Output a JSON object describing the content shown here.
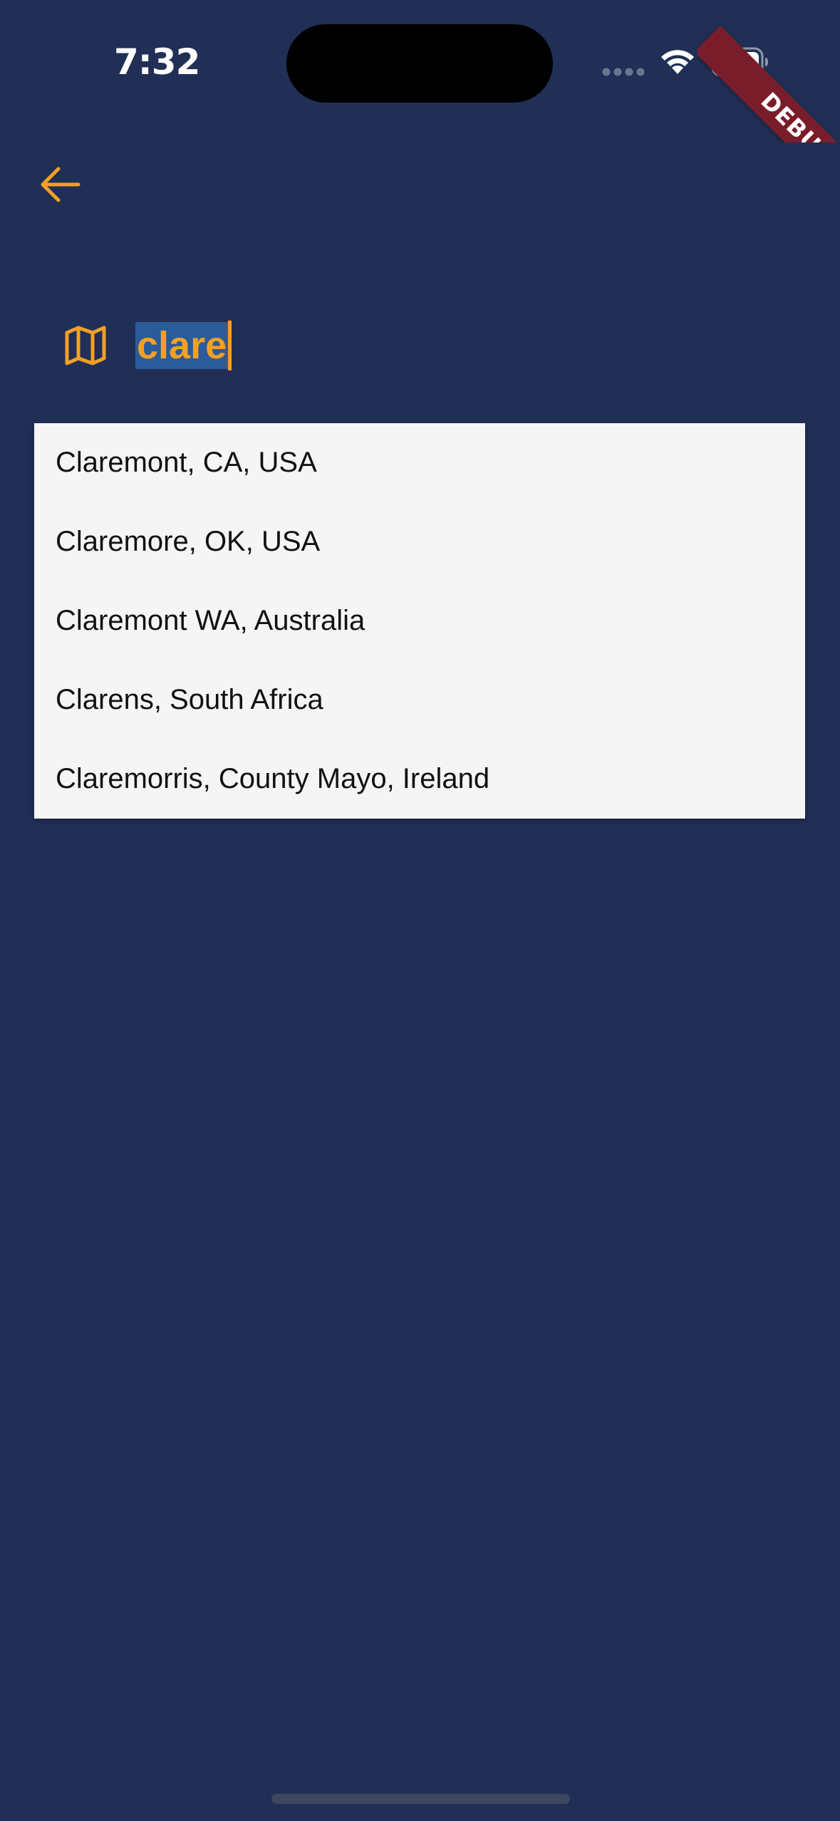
{
  "status_bar": {
    "time": "7:32",
    "icons": [
      "cellular-signal-icon",
      "wifi-icon",
      "battery-icon"
    ]
  },
  "debug_banner": {
    "label": "DEBUG",
    "color": "#7a1d2a"
  },
  "app_bar": {
    "back_icon": "arrow-back-icon"
  },
  "search": {
    "leading_icon": "map-icon",
    "value": "clare",
    "selection_color": "#2b5c99"
  },
  "suggestions": [
    {
      "label": "Claremont, CA, USA"
    },
    {
      "label": "Claremore, OK, USA"
    },
    {
      "label": "Claremont WA, Australia"
    },
    {
      "label": "Clarens, South Africa"
    },
    {
      "label": "Claremorris, County Mayo, Ireland"
    }
  ],
  "colors": {
    "background": "#212f57",
    "accent": "#f3a024",
    "dropdown_background": "#f5f5f5",
    "dropdown_text": "#111111"
  }
}
